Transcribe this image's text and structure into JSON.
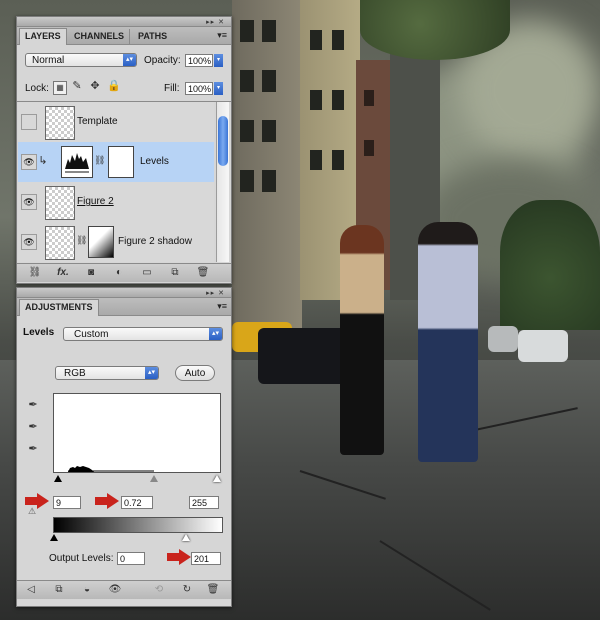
{
  "layers_panel": {
    "tabs": [
      "LAYERS",
      "CHANNELS",
      "PATHS"
    ],
    "blend_mode": "Normal",
    "opacity_label": "Opacity:",
    "opacity_value": "100%",
    "lock_label": "Lock:",
    "fill_label": "Fill:",
    "fill_value": "100%",
    "layers": [
      {
        "name": "Template",
        "visible": false,
        "selected": false
      },
      {
        "name": "Levels",
        "visible": true,
        "selected": true
      },
      {
        "name": "Figure 2",
        "visible": true,
        "selected": false
      },
      {
        "name": "Figure 2 shadow",
        "visible": true,
        "selected": false
      }
    ],
    "bottom_icons": [
      "link-icon",
      "fx-icon",
      "mask-icon",
      "adjustment-icon",
      "folder-icon",
      "new-layer-icon",
      "trash-icon"
    ],
    "fx_label": "fx."
  },
  "adjustments_panel": {
    "tab": "ADJUSTMENTS",
    "levels_label": "Levels",
    "preset_value": "Custom",
    "channel_value": "RGB",
    "auto_label": "Auto",
    "input_black": "9",
    "input_gamma": "0.72",
    "input_white": "255",
    "output_label": "Output Levels:",
    "output_black": "0",
    "output_white": "201",
    "bottom_icons": [
      "back-icon",
      "clip-icon",
      "visibility-icon",
      "eye-icon",
      "reset-icon",
      "undo-icon",
      "delete-icon"
    ]
  },
  "colors": {
    "selection": "#b7d3f5",
    "accent_blue": "#2a5fc4",
    "arrow_red": "#c9231c",
    "panel_bg": "#d6d6d6"
  }
}
